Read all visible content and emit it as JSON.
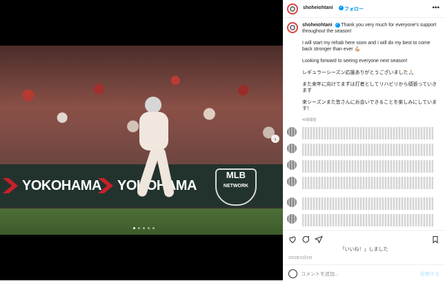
{
  "account": {
    "username": "shoheiohtani",
    "follow_label": "フォロー",
    "more_icon": "more-icon"
  },
  "post": {
    "paragraphs": [
      "Thank you very much for everyone's support throughout the season!",
      "I will start my rehab here soon and I will do my best to come back stronger than ever 💪🏼",
      "Looking forward to seeing everyone next season!",
      "レギュラーシーズン応援ありがとうございました🙏🏻",
      "また来年に向けてまずは打者としてリハビリから頑張っていきます",
      "来シーズンまた皆さんにお会いできることを楽しみにしています！"
    ],
    "posted_ago": "40週間前",
    "date": "2023年10月2日",
    "likes_text": "「いいね！」しました",
    "comment_placeholder": "コメントを追加...",
    "post_label": "投稿する"
  },
  "media": {
    "slide_total": 5,
    "slide_active": 1,
    "ad_text": "YOKOHAMA",
    "network_text": "MLB",
    "network_subtext": "NETWORK"
  },
  "colors": {
    "accent": "#0095f6",
    "muted": "#8e8e8e"
  }
}
